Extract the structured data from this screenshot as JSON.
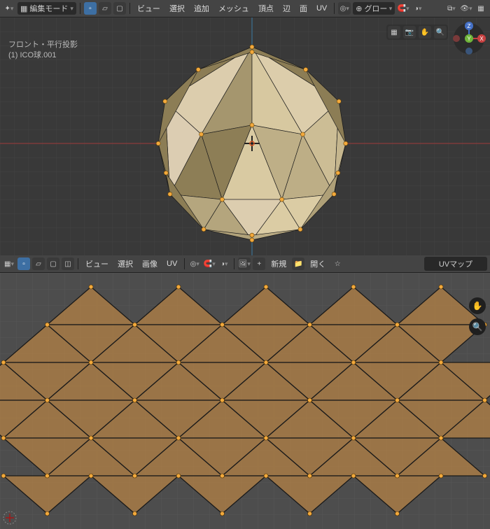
{
  "header3d": {
    "mode": "編集モード",
    "menus": [
      "ビュー",
      "選択",
      "追加",
      "メッシュ",
      "頂点",
      "辺",
      "面",
      "UV"
    ],
    "orientation": "グロー..."
  },
  "header2d": {
    "menus": [
      "ビュー",
      "選択",
      "画像",
      "UV"
    ],
    "new": "新規",
    "open": "開く",
    "dropdown": "UVマップ"
  },
  "overlay": {
    "projection": "フロント・平行投影",
    "object": "(1) ICO球.001"
  },
  "axes": {
    "x": "X",
    "y": "Y",
    "z": "Z"
  },
  "chart_data": {
    "type": "3d-mesh",
    "geometry": "Icosphere subdivisions=2, radius≈1, 42 vertices, 80 faces",
    "uv_layout": "standard unwrapped icosphere net (5 strips)",
    "projection": "Orthographic Front"
  },
  "icosphere": {
    "faces": [
      [
        [
          0,
          100,
          85
        ],
        [
          52.5,
          9.47,
          175
        ],
        [
          90,
          43.6,
          139
        ]
      ],
      [
        [
          0,
          100,
          85
        ],
        [
          -52.5,
          9.47,
          175
        ],
        [
          0,
          19,
          100
        ]
      ],
      [
        [
          0,
          100,
          85
        ],
        [
          0,
          19,
          100
        ],
        [
          52.5,
          9.47,
          175
        ]
      ],
      [
        [
          -52.5,
          9.47,
          175
        ],
        [
          0,
          100,
          85
        ],
        [
          -90,
          43.6,
          139
        ]
      ],
      [
        [
          90,
          43.6,
          139
        ],
        [
          84.9,
          -52.5,
          182
        ],
        [
          97,
          0,
          192
        ]
      ],
      [
        [
          90,
          43.6,
          139
        ],
        [
          52.5,
          9.47,
          175
        ],
        [
          84.9,
          -52.5,
          182
        ]
      ],
      [
        [
          52.5,
          9.47,
          175
        ],
        [
          30.9,
          -58,
          100
        ],
        [
          84.9,
          -52.5,
          182
        ]
      ],
      [
        [
          52.5,
          9.47,
          175
        ],
        [
          0,
          19,
          100
        ],
        [
          30.9,
          -58,
          100
        ]
      ],
      [
        [
          0,
          19,
          100
        ],
        [
          -30.9,
          -58,
          100
        ],
        [
          30.9,
          -58,
          100
        ]
      ],
      [
        [
          0,
          19,
          100
        ],
        [
          -52.5,
          9.47,
          175
        ],
        [
          -30.9,
          -58,
          100
        ]
      ],
      [
        [
          -52.5,
          9.47,
          175
        ],
        [
          -84.9,
          -52.5,
          182
        ],
        [
          -30.9,
          -58,
          100
        ]
      ],
      [
        [
          -52.5,
          9.47,
          175
        ],
        [
          -90,
          43.6,
          139
        ],
        [
          -84.9,
          -52.5,
          182
        ]
      ],
      [
        [
          -90,
          43.6,
          139
        ],
        [
          -97,
          0,
          192
        ],
        [
          -84.9,
          -52.5,
          182
        ]
      ],
      [
        [
          30.9,
          -58,
          100
        ],
        [
          50,
          -89,
          193
        ],
        [
          84.9,
          -52.5,
          182
        ]
      ],
      [
        [
          30.9,
          -58,
          100
        ],
        [
          0,
          -100,
          127
        ],
        [
          50,
          -89,
          193
        ]
      ],
      [
        [
          -30.9,
          -58,
          100
        ],
        [
          0,
          -100,
          127
        ],
        [
          30.9,
          -58,
          100
        ]
      ],
      [
        [
          -30.9,
          -58,
          100
        ],
        [
          -50,
          -89,
          193
        ],
        [
          0,
          -100,
          127
        ]
      ],
      [
        [
          -84.9,
          -52.5,
          182
        ],
        [
          -50,
          -89,
          193
        ],
        [
          -30.9,
          -58,
          100
        ]
      ],
      [
        [
          0,
          100,
          85
        ],
        [
          90,
          43.6,
          139
        ],
        [
          55.6,
          76.5,
          209
        ]
      ],
      [
        [
          0,
          100,
          85
        ],
        [
          -55.6,
          76.5,
          209
        ],
        [
          -90,
          43.6,
          139
        ]
      ],
      [
        [
          -90,
          43.6,
          139
        ],
        [
          -55.6,
          76.5,
          209
        ],
        [
          -97,
          0,
          192
        ]
      ],
      [
        [
          90,
          43.6,
          139
        ],
        [
          97,
          0,
          192
        ],
        [
          55.6,
          76.5,
          209
        ]
      ],
      [
        [
          0,
          100,
          85
        ],
        [
          55.6,
          76.5,
          209
        ],
        [
          0,
          94.7,
          223
        ]
      ],
      [
        [
          0,
          100,
          85
        ],
        [
          0,
          94.7,
          223
        ],
        [
          -55.6,
          76.5,
          209
        ]
      ],
      [
        [
          84.9,
          -52.5,
          182
        ],
        [
          89,
          -30.5,
          232
        ],
        [
          97,
          0,
          192
        ]
      ],
      [
        [
          84.9,
          -52.5,
          182
        ],
        [
          50,
          -89,
          193
        ],
        [
          89,
          -30.5,
          232
        ]
      ],
      [
        [
          -84.9,
          -52.5,
          182
        ],
        [
          -97,
          0,
          192
        ],
        [
          -89,
          -30.5,
          232
        ]
      ],
      [
        [
          -84.9,
          -52.5,
          182
        ],
        [
          -89,
          -30.5,
          232
        ],
        [
          -50,
          -89,
          193
        ]
      ],
      [
        [
          0,
          -100,
          127
        ],
        [
          -50,
          -89,
          193
        ],
        [
          0,
          -95,
          229
        ]
      ],
      [
        [
          0,
          -100,
          127
        ],
        [
          0,
          -95,
          229
        ],
        [
          50,
          -89,
          193
        ]
      ]
    ],
    "light": [
      -0.4,
      0.6,
      1
    ]
  },
  "uv_net": {
    "step": 62.5,
    "h": 54,
    "row1": [
      [
        125,
        1
      ],
      [
        250,
        1
      ],
      [
        375,
        1
      ],
      [
        500,
        1
      ],
      [
        625,
        1
      ]
    ],
    "rows": [
      [
        [
          62.5,
          1
        ],
        [
          125,
          -1
        ],
        [
          187.5,
          1
        ],
        [
          250,
          -1
        ],
        [
          312.5,
          1
        ],
        [
          375,
          -1
        ],
        [
          437.5,
          1
        ],
        [
          500,
          -1
        ],
        [
          562.5,
          1
        ],
        [
          625,
          -1
        ]
      ],
      [
        [
          0,
          1
        ],
        [
          62.5,
          -1
        ],
        [
          125,
          1
        ],
        [
          187.5,
          -1
        ],
        [
          250,
          1
        ],
        [
          312.5,
          -1
        ],
        [
          375,
          1
        ],
        [
          437.5,
          -1
        ],
        [
          500,
          1
        ],
        [
          562.5,
          -1
        ],
        [
          625,
          1
        ],
        [
          687.5,
          -1
        ]
      ],
      [
        [
          0,
          -1
        ],
        [
          62.5,
          1
        ],
        [
          125,
          -1
        ],
        [
          187.5,
          1
        ],
        [
          250,
          -1
        ],
        [
          312.5,
          1
        ],
        [
          375,
          -1
        ],
        [
          437.5,
          1
        ],
        [
          500,
          -1
        ],
        [
          562.5,
          1
        ],
        [
          625,
          -1
        ],
        [
          687.5,
          1
        ]
      ],
      [
        [
          62.5,
          -1
        ],
        [
          125,
          1
        ],
        [
          187.5,
          -1
        ],
        [
          250,
          1
        ],
        [
          312.5,
          -1
        ],
        [
          375,
          1
        ],
        [
          437.5,
          -1
        ],
        [
          500,
          1
        ],
        [
          562.5,
          -1
        ],
        [
          625,
          1
        ]
      ]
    ],
    "row6": [
      [
        62.5,
        -1
      ],
      [
        187.5,
        -1
      ],
      [
        312.5,
        -1
      ],
      [
        437.5,
        -1
      ],
      [
        562.5,
        -1
      ]
    ]
  }
}
